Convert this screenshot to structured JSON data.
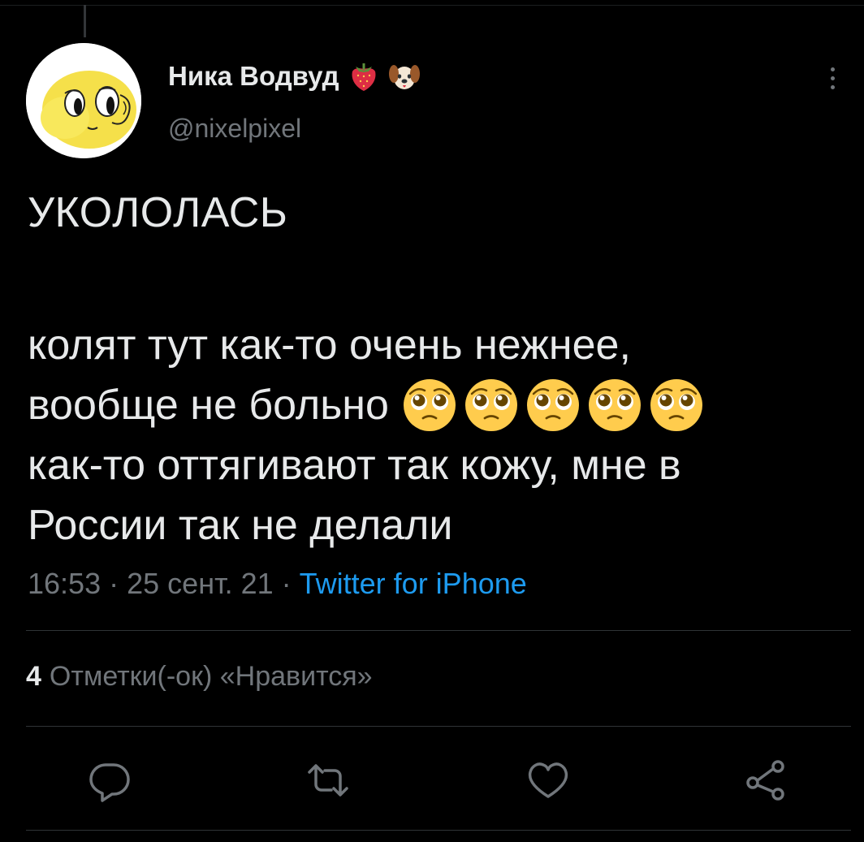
{
  "author": {
    "display_name": "Ника Водвуд",
    "username": "@nixelpixel",
    "badges": [
      "strawberry-emoji",
      "dog-face-emoji"
    ]
  },
  "tweet": {
    "headline": "УКОЛОЛАСЬ",
    "lines": [
      "колят тут как-то очень нежнее,",
      "вообще не больно",
      "как-то оттягивают так кожу, мне в",
      "России так не делали"
    ],
    "emoji": [
      "pleading-face-emoji",
      "pleading-face-emoji",
      "pleading-face-emoji",
      "pleading-face-emoji",
      "pleading-face-emoji"
    ]
  },
  "meta": {
    "time": "16:53",
    "date": "25 сент. 21",
    "separator": "·",
    "source": "Twitter for iPhone"
  },
  "likes": {
    "count": "4",
    "label": "Отметки(-ок) «Нравится»"
  },
  "actions": [
    "reply-icon",
    "retweet-icon",
    "like-icon",
    "share-icon"
  ],
  "colors": {
    "background": "#000000",
    "text": "#e7e9ea",
    "secondary": "#71767b",
    "link": "#1d9bf0",
    "divider": "#2f3336"
  }
}
